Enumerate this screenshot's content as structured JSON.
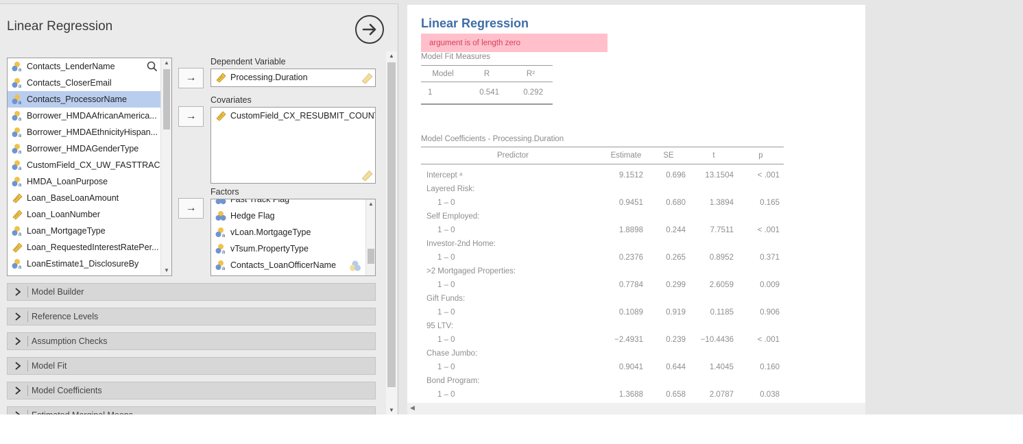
{
  "options_panel": {
    "title": "Linear Regression",
    "variables": [
      {
        "name": "Contacts_LenderName",
        "type": "nominal"
      },
      {
        "name": "Contacts_CloserEmail",
        "type": "nominal"
      },
      {
        "name": "Contacts_ProcessorName",
        "type": "nominal",
        "selected": true
      },
      {
        "name": "Borrower_HMDAAfricanAmerica...",
        "type": "nominal"
      },
      {
        "name": "Borrower_HMDAEthnicityHispan...",
        "type": "nominal"
      },
      {
        "name": "Borrower_HMDAGenderType",
        "type": "nominal"
      },
      {
        "name": "CustomField_CX_UW_FASTTRACK",
        "type": "nominal"
      },
      {
        "name": "HMDA_LoanPurpose",
        "type": "nominal"
      },
      {
        "name": "Loan_BaseLoanAmount",
        "type": "continuous"
      },
      {
        "name": "Loan_LoanNumber",
        "type": "continuous"
      },
      {
        "name": "Loan_MortgageType",
        "type": "nominal"
      },
      {
        "name": "Loan_RequestedInterestRatePer...",
        "type": "continuous"
      },
      {
        "name": "LoanEstimate1_DisclosureBy",
        "type": "nominal"
      }
    ],
    "dependent_label": "Dependent Variable",
    "dependent_value": "Processing.Duration",
    "covariates_label": "Covariates",
    "covariates": [
      "CustomField_CX_RESUBMIT_COUNT"
    ],
    "factors_label": "Factors",
    "factors": [
      {
        "name": "Fast Track Flag",
        "type": "binary"
      },
      {
        "name": "Hedge Flag",
        "type": "binary"
      },
      {
        "name": "vLoan.MortgageType",
        "type": "nominal"
      },
      {
        "name": "vTsum.PropertyType",
        "type": "nominal"
      },
      {
        "name": "Contacts_LoanOfficerName",
        "type": "nominal"
      }
    ],
    "sections": [
      "Model Builder",
      "Reference Levels",
      "Assumption Checks",
      "Model Fit",
      "Model Coefficients",
      "Estimated Marginal Means"
    ]
  },
  "results": {
    "title": "Linear Regression",
    "error": "argument is of length zero",
    "fit_caption": "Model Fit Measures",
    "fit_headers": [
      "Model",
      "R",
      "R²"
    ],
    "fit_rows": [
      [
        "1",
        "0.541",
        "0.292"
      ]
    ],
    "coef_caption": "Model Coefficients - Processing.Duration",
    "coef_headers": [
      "Predictor",
      "Estimate",
      "SE",
      "t",
      "p"
    ],
    "coef_rows": [
      {
        "label": "Intercept ᵃ",
        "estimate": "9.1512",
        "se": "0.696",
        "t": "13.1504",
        "p": "< .001"
      },
      {
        "label": "Layered Risk:",
        "group": true
      },
      {
        "label": "1 – 0",
        "sub": true,
        "estimate": "0.9451",
        "se": "0.680",
        "t": "1.3894",
        "p": "0.165"
      },
      {
        "label": "Self Employed:",
        "group": true
      },
      {
        "label": "1 – 0",
        "sub": true,
        "estimate": "1.8898",
        "se": "0.244",
        "t": "7.7511",
        "p": "< .001"
      },
      {
        "label": "Investor-2nd Home:",
        "group": true
      },
      {
        "label": "1 – 0",
        "sub": true,
        "estimate": "0.2376",
        "se": "0.265",
        "t": "0.8952",
        "p": "0.371"
      },
      {
        "label": ">2 Mortgaged Properties:",
        "group": true
      },
      {
        "label": "1 – 0",
        "sub": true,
        "estimate": "0.7784",
        "se": "0.299",
        "t": "2.6059",
        "p": "0.009"
      },
      {
        "label": "Gift Funds:",
        "group": true
      },
      {
        "label": "1 – 0",
        "sub": true,
        "estimate": "0.1089",
        "se": "0.919",
        "t": "0.1185",
        "p": "0.906"
      },
      {
        "label": "95 LTV:",
        "group": true
      },
      {
        "label": "1 – 0",
        "sub": true,
        "estimate": "−2.4931",
        "se": "0.239",
        "t": "−10.4436",
        "p": "< .001"
      },
      {
        "label": "Chase Jumbo:",
        "group": true
      },
      {
        "label": "1 – 0",
        "sub": true,
        "estimate": "0.9041",
        "se": "0.644",
        "t": "1.4045",
        "p": "0.160"
      },
      {
        "label": "Bond Program:",
        "group": true
      },
      {
        "label": "1 – 0",
        "sub": true,
        "estimate": "1.3688",
        "se": "0.658",
        "t": "2.0787",
        "p": "0.038"
      }
    ]
  },
  "icons": {
    "nominal": "nominal-variable-icon",
    "continuous": "continuous-variable-icon",
    "binary": "binary-variable-icon"
  },
  "colors": {
    "accent_title": "#3e6da6",
    "error_bg": "#ffc0cb",
    "error_text": "#d6405b",
    "selected_row": "#b9cdee"
  }
}
